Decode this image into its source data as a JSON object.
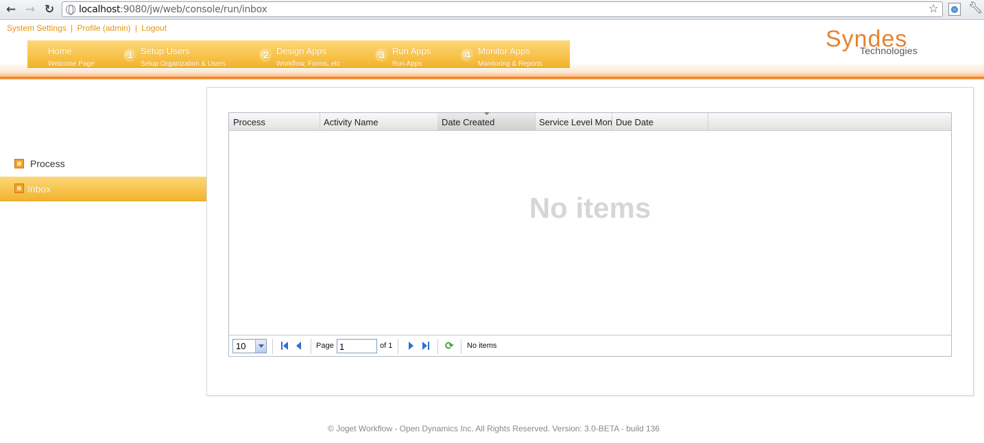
{
  "browser": {
    "url_host": "localhost",
    "url_path": ":9080/jw/web/console/run/inbox"
  },
  "header": {
    "links": {
      "system_settings": "System Settings",
      "profile": "Profile (admin)",
      "logout": "Logout",
      "separator": "|"
    },
    "logo": {
      "name": "Syndes",
      "sub": "Technologies"
    }
  },
  "menu": [
    {
      "num": "",
      "title": "Home",
      "sub": "Welcome Page"
    },
    {
      "num": "1",
      "title": "Setup Users",
      "sub": "Setup Organization & Users"
    },
    {
      "num": "2",
      "title": "Design Apps",
      "sub": "Workflow, Forms, etc"
    },
    {
      "num": "3",
      "title": "Run Apps",
      "sub": "Run Apps"
    },
    {
      "num": "4",
      "title": "Monitor Apps",
      "sub": "Monitoring & Reports"
    }
  ],
  "sidebar": {
    "items": [
      {
        "label": "Process",
        "active": false
      },
      {
        "label": "Inbox",
        "active": true
      }
    ]
  },
  "grid": {
    "columns": [
      "Process",
      "Activity Name",
      "Date Created",
      "Service Level Mon",
      "Due Date"
    ],
    "sorted_column": "Date Created",
    "empty_message": "No items",
    "pager": {
      "page_size": "10",
      "page_label": "Page",
      "page_value": "1",
      "of_label": "of 1",
      "status": "No items"
    }
  },
  "footer": {
    "text": "© Joget Workflow - Open Dynamics Inc. All Rights Reserved. Version: 3.0-BETA - build 136"
  },
  "colors": {
    "accent_orange": "#f08a2c",
    "menu_yellow": "#f7c24a",
    "link_color": "#e4930e"
  }
}
